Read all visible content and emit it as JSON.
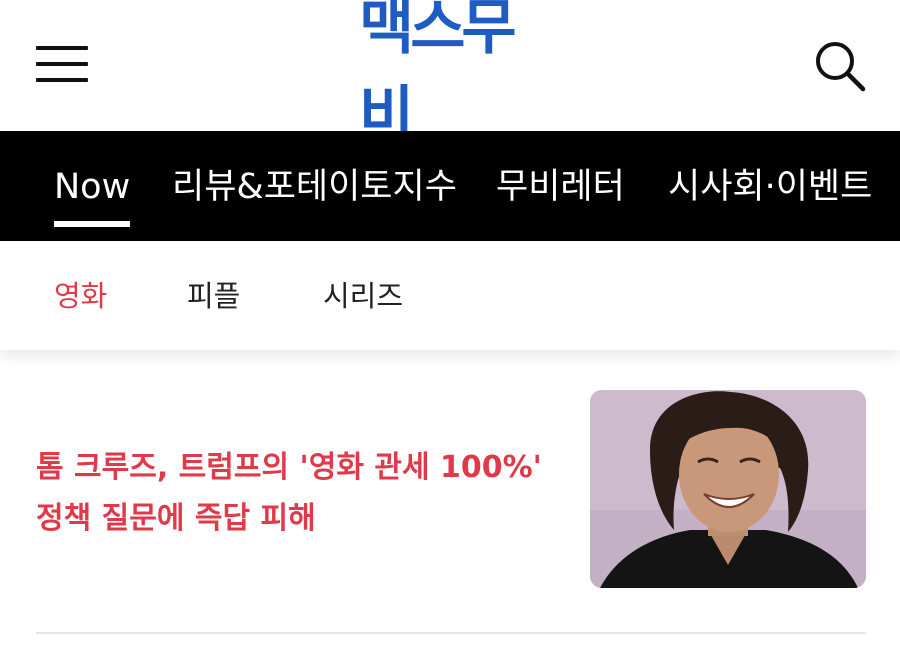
{
  "header": {
    "logo_text": "맥스무비",
    "brand_color": "#1f5cc2"
  },
  "main_nav": {
    "items": [
      {
        "label": "Now",
        "active": true
      },
      {
        "label": "리뷰&포테이토지수",
        "active": false
      },
      {
        "label": "무비레터",
        "active": false
      },
      {
        "label": "시사회·이벤트",
        "active": false
      }
    ]
  },
  "sub_nav": {
    "tabs": [
      {
        "label": "영화",
        "active": true
      },
      {
        "label": "피플",
        "active": false
      },
      {
        "label": "시리즈",
        "active": false
      }
    ],
    "active_color": "#e03a4a"
  },
  "article": {
    "headline": "톰 크루즈, 트럼프의 '영화 관세 100%' 정책 질문에 즉답 피해",
    "headline_color": "#e03a4a",
    "thumbnail_alt": "smiling man with long dark hair in black shirt"
  },
  "icons": {
    "menu": "hamburger-menu-icon",
    "search": "search-icon"
  }
}
